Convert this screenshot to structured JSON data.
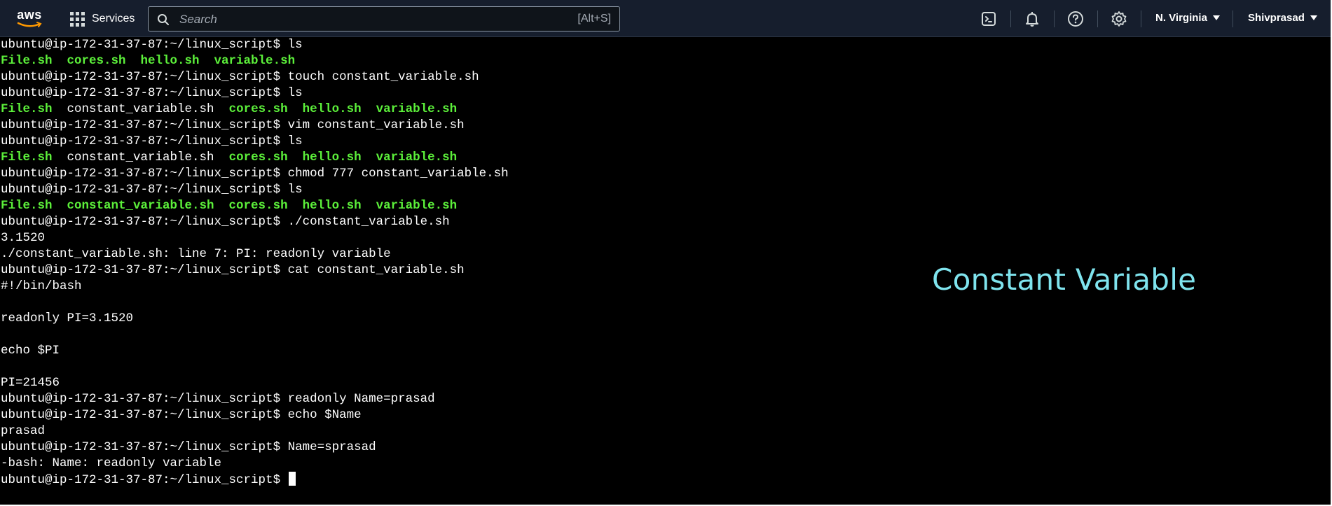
{
  "topbar": {
    "logo_text": "aws",
    "services_label": "Services",
    "search_placeholder": "Search",
    "search_shortcut": "[Alt+S]",
    "icons": [
      "cloudshell-icon",
      "bell-icon",
      "help-icon",
      "settings-icon"
    ],
    "region_label": "N. Virginia",
    "account_label": "Shivprasad"
  },
  "terminal": {
    "lines": [
      {
        "prompt": "ubuntu@ip-172-31-37-87:~/linux_script$ ",
        "cmd": "ls"
      },
      {
        "green": "File.sh  cores.sh  hello.sh  variable.sh"
      },
      {
        "prompt": "ubuntu@ip-172-31-37-87:~/linux_script$ ",
        "cmd": "touch constant_variable.sh"
      },
      {
        "prompt": "ubuntu@ip-172-31-37-87:~/linux_script$ ",
        "cmd": "ls"
      },
      {
        "mixed": [
          [
            "File.sh",
            true
          ],
          [
            "  constant_variable.sh  ",
            false
          ],
          [
            "cores.sh  hello.sh  variable.sh",
            true
          ]
        ]
      },
      {
        "prompt": "ubuntu@ip-172-31-37-87:~/linux_script$ ",
        "cmd": "vim constant_variable.sh"
      },
      {
        "prompt": "ubuntu@ip-172-31-37-87:~/linux_script$ ",
        "cmd": "ls"
      },
      {
        "mixed": [
          [
            "File.sh",
            true
          ],
          [
            "  constant_variable.sh  ",
            false
          ],
          [
            "cores.sh  hello.sh  variable.sh",
            true
          ]
        ]
      },
      {
        "prompt": "ubuntu@ip-172-31-37-87:~/linux_script$ ",
        "cmd": "chmod 777 constant_variable.sh"
      },
      {
        "prompt": "ubuntu@ip-172-31-37-87:~/linux_script$ ",
        "cmd": "ls"
      },
      {
        "green": "File.sh  constant_variable.sh  cores.sh  hello.sh  variable.sh"
      },
      {
        "prompt": "ubuntu@ip-172-31-37-87:~/linux_script$ ",
        "cmd": "./constant_variable.sh"
      },
      {
        "text": "3.1520"
      },
      {
        "text": "./constant_variable.sh: line 7: PI: readonly variable"
      },
      {
        "prompt": "ubuntu@ip-172-31-37-87:~/linux_script$ ",
        "cmd": "cat constant_variable.sh"
      },
      {
        "text": "#!/bin/bash"
      },
      {
        "text": ""
      },
      {
        "text": "readonly PI=3.1520"
      },
      {
        "text": ""
      },
      {
        "text": "echo $PI"
      },
      {
        "text": ""
      },
      {
        "text": "PI=21456"
      },
      {
        "prompt": "ubuntu@ip-172-31-37-87:~/linux_script$ ",
        "cmd": "readonly Name=prasad"
      },
      {
        "prompt": "ubuntu@ip-172-31-37-87:~/linux_script$ ",
        "cmd": "echo $Name"
      },
      {
        "text": "prasad"
      },
      {
        "prompt": "ubuntu@ip-172-31-37-87:~/linux_script$ ",
        "cmd": "Name=sprasad"
      },
      {
        "text": "-bash: Name: readonly variable"
      },
      {
        "prompt": "ubuntu@ip-172-31-37-87:~/linux_script$ ",
        "cmd": "",
        "cursor": true
      }
    ],
    "overlay_title": "Constant Variable"
  },
  "colors": {
    "nav_bg": "#161e2d",
    "terminal_bg": "#000000",
    "terminal_text": "#ffffff",
    "executable_green": "#5cf03a",
    "overlay_cyan": "#7fe4ee"
  }
}
